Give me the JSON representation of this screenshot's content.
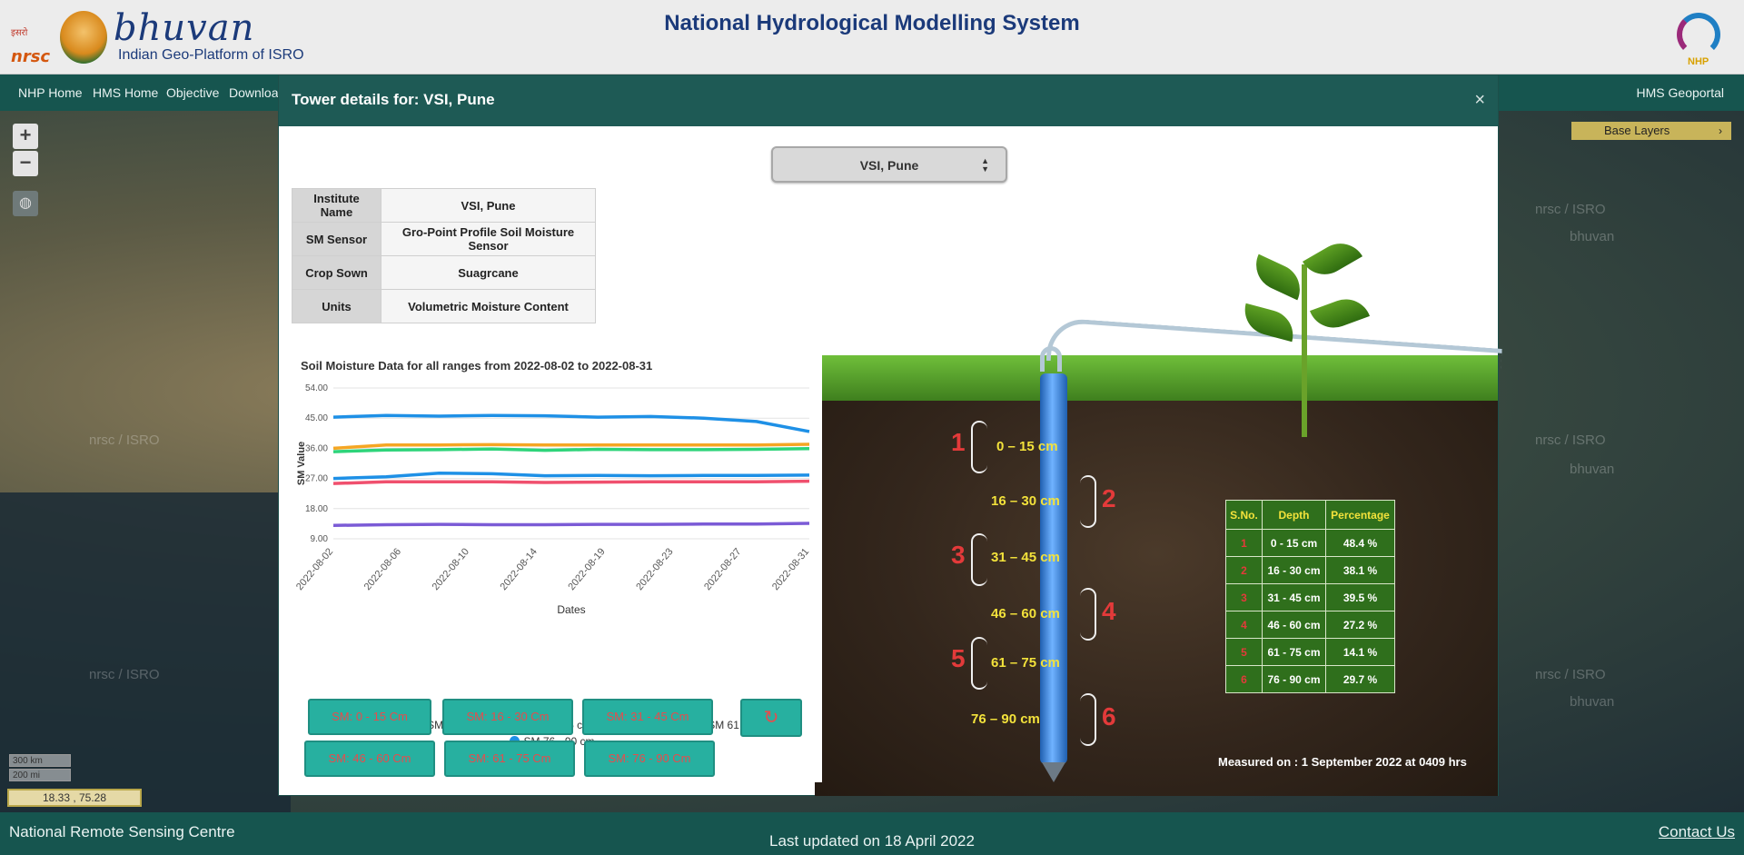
{
  "header": {
    "nrsc_hindi": "इसरो",
    "nrsc_label": "nrsc",
    "bhuvan_word": "bhuvan",
    "bhuvan_sub": "Indian Geo-Platform of ISRO",
    "title": "National Hydrological Modelling System",
    "nhp_label": "NHP"
  },
  "nav": {
    "items": [
      "NHP Home",
      "HMS Home",
      "Objective",
      "Downloa"
    ],
    "right": "HMS Geoportal"
  },
  "map": {
    "zoom_in": "+",
    "zoom_out": "−",
    "base_layers": "Base Layers",
    "scale_km": "300 km",
    "scale_mi": "200 mi",
    "coords": "18.33 , 75.28",
    "watermarks": [
      "nrsc / ISRO",
      "bhuvan"
    ]
  },
  "footer": {
    "left": "National Remote Sensing Centre",
    "center": "Last updated on 18 April 2022",
    "right": "Contact Us"
  },
  "modal": {
    "title": "Tower details for: VSI, Pune",
    "close": "×",
    "select_value": "VSI, Pune",
    "info": [
      {
        "key": "Institute Name",
        "value": "VSI, Pune"
      },
      {
        "key": "SM Sensor",
        "value": "Gro-Point Profile Soil Moisture Sensor"
      },
      {
        "key": "Crop Sown",
        "value": "Suagrcane"
      },
      {
        "key": "Units",
        "value": "Volumetric Moisture Content"
      }
    ],
    "range_buttons": [
      "SM: 0 - 15 Cm",
      "SM: 16 - 30 Cm",
      "SM: 31 - 45 Cm",
      "SM: 46 - 60 Cm",
      "SM: 61 - 75 Cm",
      "SM: 76 - 90 Cm"
    ],
    "refresh_icon": "↻",
    "depth_labels": [
      "0 – 15 cm",
      "16 – 30 cm",
      "31 – 45 cm",
      "46 – 60 cm",
      "61 – 75 cm",
      "76 – 90 cm"
    ],
    "depth_numbers": [
      "1",
      "2",
      "3",
      "4",
      "5",
      "6"
    ],
    "depth_table": {
      "headers": [
        "S.No.",
        "Depth",
        "Percentage"
      ],
      "rows": [
        [
          "1",
          "0 - 15 cm",
          "48.4 %"
        ],
        [
          "2",
          "16 - 30 cm",
          "38.1 %"
        ],
        [
          "3",
          "31 - 45 cm",
          "39.5 %"
        ],
        [
          "4",
          "46 - 60 cm",
          "27.2 %"
        ],
        [
          "5",
          "61 - 75 cm",
          "14.1 %"
        ],
        [
          "6",
          "76 - 90 cm",
          "29.7 %"
        ]
      ]
    },
    "measured": "Measured on : 1 September 2022 at 0409 hrs"
  },
  "chart_data": {
    "type": "line",
    "title": "Soil Moisture Data for all ranges from 2022-08-02 to 2022-08-31",
    "xlabel": "Dates",
    "ylabel": "SM Value",
    "ylim": [
      9,
      54
    ],
    "yticks": [
      "9.00",
      "18.00",
      "27.00",
      "36.00",
      "45.00",
      "54.00"
    ],
    "x_ticks": [
      "2022-08-02",
      "2022-08-06",
      "2022-08-10",
      "2022-08-14",
      "2022-08-19",
      "2022-08-23",
      "2022-08-27",
      "2022-08-31"
    ],
    "series": [
      {
        "name": "SM 0 - 15 cm",
        "color": "#1e90e6",
        "values": [
          45.3,
          45.8,
          45.6,
          45.8,
          45.7,
          45.3,
          45.5,
          45.0,
          44.0,
          41.0
        ]
      },
      {
        "name": "SM 16 - 30 cm",
        "color": "#2ed47a",
        "values": [
          35.0,
          35.5,
          35.6,
          35.8,
          35.4,
          35.7,
          35.6,
          35.6,
          35.7,
          35.9
        ]
      },
      {
        "name": "SM 30 - 45 cm",
        "color": "#f5a623",
        "values": [
          36.0,
          37.0,
          37.0,
          37.1,
          37.0,
          37.0,
          37.0,
          37.0,
          37.0,
          37.2
        ]
      },
      {
        "name": "SM 46 - 60 cm",
        "color": "#f0506e",
        "values": [
          25.5,
          26.0,
          26.0,
          26.0,
          25.8,
          25.9,
          26.0,
          26.0,
          26.0,
          26.2
        ]
      },
      {
        "name": "SM 61 - 75 cm",
        "color": "#7b5bd6",
        "values": [
          13.0,
          13.2,
          13.3,
          13.2,
          13.2,
          13.3,
          13.3,
          13.4,
          13.4,
          13.6
        ]
      },
      {
        "name": "SM 76 - 90 cm",
        "color": "#1e90e6",
        "values": [
          27.0,
          27.5,
          28.6,
          28.4,
          27.8,
          27.9,
          27.8,
          27.9,
          27.9,
          28.0
        ]
      }
    ]
  }
}
